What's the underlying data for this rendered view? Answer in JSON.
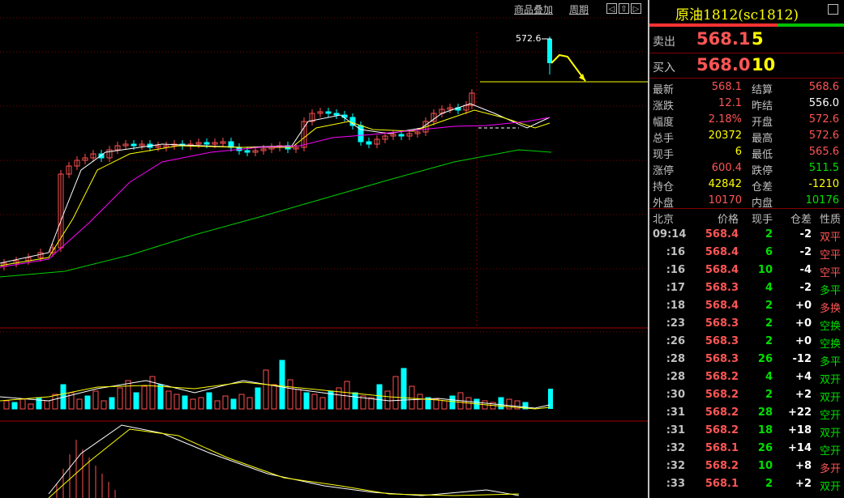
{
  "toolbar": {
    "overlay_label": "商品叠加",
    "period_label": "周期",
    "nav_left": "◁",
    "nav_up": "⇧",
    "nav_right": "▷"
  },
  "chart": {
    "high_label": "572.6",
    "colors": {
      "up": "#ff5050",
      "down": "#00ffff",
      "ma_fast": "#ffffff",
      "ma_mid": "#ffff00",
      "ma_slow": "#ff00ff",
      "ma_long": "#00d000",
      "grid": "#800000"
    }
  },
  "quote": {
    "title": "原油1812(sc1812)",
    "sell_label": "卖出",
    "sell_price": "568.1",
    "sell_vol": "5",
    "buy_label": "买入",
    "buy_price": "568.0",
    "buy_vol": "10",
    "stats": [
      {
        "l1": "最新",
        "v1": "568.1",
        "c1": "red",
        "l2": "结算",
        "v2": "568.6",
        "c2": "red"
      },
      {
        "l1": "涨跌",
        "v1": "12.1",
        "c1": "red",
        "l2": "昨结",
        "v2": "556.0",
        "c2": "white"
      },
      {
        "l1": "幅度",
        "v1": "2.18%",
        "c1": "red",
        "l2": "开盘",
        "v2": "572.6",
        "c2": "red"
      },
      {
        "l1": "总手",
        "v1": "20372",
        "c1": "yellow",
        "l2": "最高",
        "v2": "572.6",
        "c2": "red"
      },
      {
        "l1": "现手",
        "v1": "6",
        "c1": "yellow",
        "l2": "最低",
        "v2": "565.6",
        "c2": "red"
      },
      {
        "l1": "涨停",
        "v1": "600.4",
        "c1": "red",
        "l2": "跌停",
        "v2": "511.5",
        "c2": "green"
      },
      {
        "l1": "持仓",
        "v1": "42842",
        "c1": "yellow",
        "l2": "仓差",
        "v2": "-1210",
        "c2": "yellow"
      },
      {
        "l1": "外盘",
        "v1": "10170",
        "c1": "red",
        "l2": "内盘",
        "v2": "10176",
        "c2": "green"
      }
    ]
  },
  "ticks": {
    "headers": {
      "time": "北京",
      "price": "价格",
      "vol": "现手",
      "oi": "仓差",
      "nature": "性质"
    },
    "rows": [
      {
        "time": "09:14",
        "price": "568.4",
        "vol": "2",
        "oi": "-2",
        "nature": "双平",
        "nc": "red"
      },
      {
        "time": ":16",
        "price": "568.4",
        "vol": "6",
        "oi": "-2",
        "nature": "空平",
        "nc": "red"
      },
      {
        "time": ":16",
        "price": "568.4",
        "vol": "10",
        "oi": "-4",
        "nature": "空平",
        "nc": "red"
      },
      {
        "time": ":17",
        "price": "568.3",
        "vol": "4",
        "oi": "-2",
        "nature": "多平",
        "nc": "green"
      },
      {
        "time": ":18",
        "price": "568.4",
        "vol": "2",
        "oi": "+0",
        "nature": "多换",
        "nc": "red"
      },
      {
        "time": ":23",
        "price": "568.3",
        "vol": "2",
        "oi": "+0",
        "nature": "空换",
        "nc": "green"
      },
      {
        "time": ":26",
        "price": "568.3",
        "vol": "2",
        "oi": "+0",
        "nature": "空换",
        "nc": "green"
      },
      {
        "time": ":28",
        "price": "568.3",
        "vol": "26",
        "oi": "-12",
        "nature": "多平",
        "nc": "green"
      },
      {
        "time": ":28",
        "price": "568.2",
        "vol": "4",
        "oi": "+4",
        "nature": "双开",
        "nc": "green"
      },
      {
        "time": ":30",
        "price": "568.2",
        "vol": "2",
        "oi": "+2",
        "nature": "双开",
        "nc": "green"
      },
      {
        "time": ":31",
        "price": "568.2",
        "vol": "28",
        "oi": "+22",
        "nature": "空开",
        "nc": "green"
      },
      {
        "time": ":31",
        "price": "568.2",
        "vol": "18",
        "oi": "+18",
        "nature": "双开",
        "nc": "green"
      },
      {
        "time": ":32",
        "price": "568.1",
        "vol": "26",
        "oi": "+14",
        "nature": "空开",
        "nc": "green"
      },
      {
        "time": ":32",
        "price": "568.2",
        "vol": "10",
        "oi": "+8",
        "nature": "多开",
        "nc": "red"
      },
      {
        "time": ":33",
        "price": "568.1",
        "vol": "2",
        "oi": "+2",
        "nature": "双开",
        "nc": "green"
      }
    ]
  }
}
